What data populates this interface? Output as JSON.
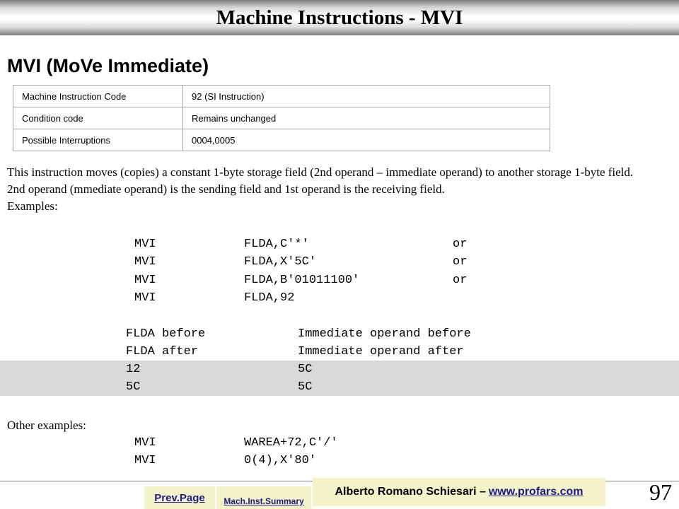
{
  "title": "Machine Instructions - MVI",
  "heading": "MVI (MoVe Immediate)",
  "info_table": [
    {
      "key": "Machine Instruction Code",
      "value": "92 (SI Instruction)"
    },
    {
      "key": "Condition code",
      "value": "Remains unchanged"
    },
    {
      "key": "Possible Interruptions",
      "value": "0004,0005"
    }
  ],
  "paragraphs": [
    "This instruction moves (copies) a constant 1-byte storage field (2nd operand – immediate operand) to another storage 1-byte field.",
    "2nd operand (mmediate operand) is the sending field and 1st operand is the receiving field.",
    "Examples:"
  ],
  "examples": [
    {
      "op": "MVI",
      "operand": "FLDA,C'*'",
      "suffix": "or"
    },
    {
      "op": "MVI",
      "operand": "FLDA,X'5C'",
      "suffix": "or"
    },
    {
      "op": "MVI",
      "operand": "FLDA,B'01011100'",
      "suffix": "or"
    },
    {
      "op": "MVI",
      "operand": "FLDA,92",
      "suffix": ""
    }
  ],
  "compare": [
    {
      "left": "FLDA before",
      "right": "Immediate operand before"
    },
    {
      "left": "FLDA after",
      "right": "Immediate operand after"
    },
    {
      "left": "12",
      "right": "5C"
    },
    {
      "left": "5C",
      "right": "5C"
    }
  ],
  "other_label": "Other examples:",
  "other_examples": [
    {
      "op": "MVI",
      "operand": "WAREA+72,C'/'"
    },
    {
      "op": "MVI",
      "operand": "0(4),X'80'"
    }
  ],
  "footer": {
    "prev_page": "Prev.Page",
    "summary": "Mach.Inst.Summary",
    "author": "Alberto Romano Schiesari –",
    "website": "www.profars.com",
    "page_number": "97"
  }
}
